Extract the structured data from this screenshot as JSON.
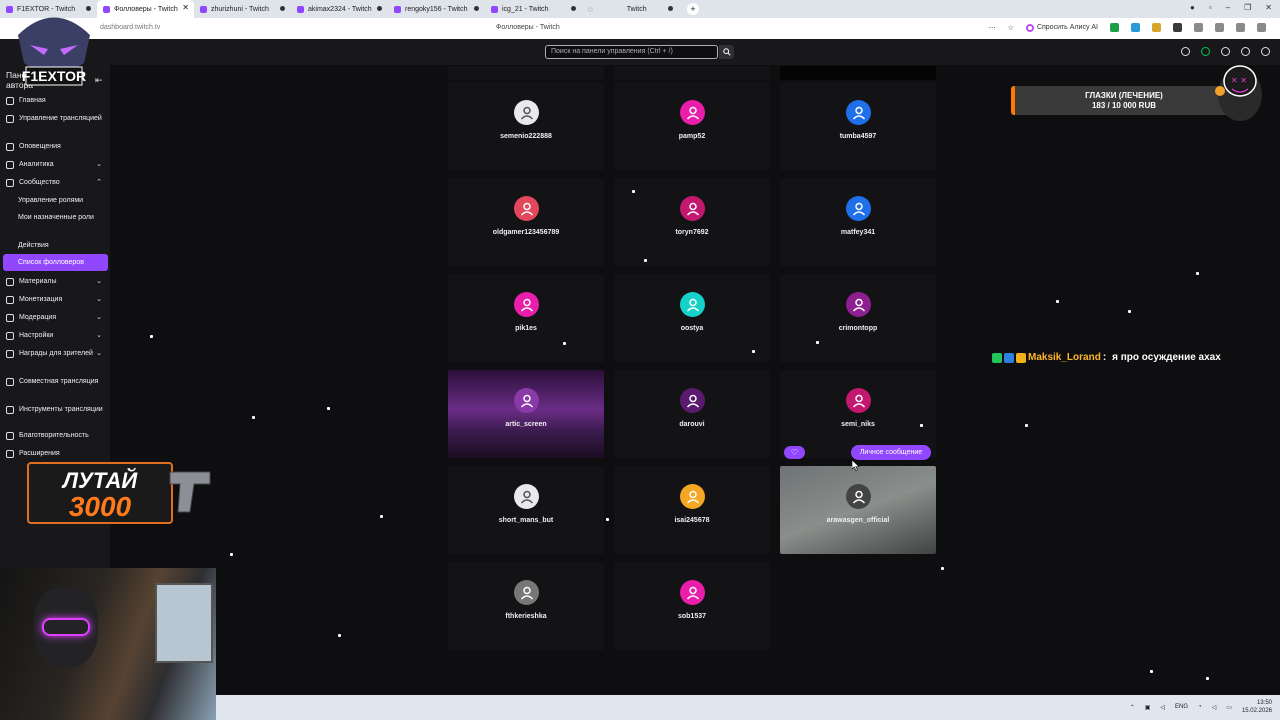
{
  "browser": {
    "tabs": [
      {
        "label": "F1EXTOR - Twitch",
        "active": false
      },
      {
        "label": "Фолловеры - Twitch",
        "active": true
      },
      {
        "label": "zhurizhuni - Twitch",
        "active": false
      },
      {
        "label": "akimax2324 - Twitch",
        "active": false
      },
      {
        "label": "rengoky156 - Twitch",
        "active": false
      },
      {
        "label": "icg_21 - Twitch",
        "active": false
      },
      {
        "label": "Twitch",
        "active": false
      }
    ],
    "url": "dashboard.twitch.tv",
    "page_title": "Фолловеры - Twitch",
    "ask_alice": "Спросить Алису AI"
  },
  "topbar": {
    "search_placeholder": "Поиск на панели управления (Ctrl + /)"
  },
  "sidebar": {
    "header": "Панель управления автора",
    "items": [
      {
        "label": "Главная"
      },
      {
        "label": "Управление трансляцией"
      },
      {
        "label": "Оповещения"
      },
      {
        "label": "Аналитика"
      },
      {
        "label": "Сообщество"
      },
      {
        "label": "Управление ролями"
      },
      {
        "label": "Мои назначенные роли"
      },
      {
        "label": "Действия"
      },
      {
        "label": "Список фолловеров"
      },
      {
        "label": "Материалы"
      },
      {
        "label": "Монетизация"
      },
      {
        "label": "Модерация"
      },
      {
        "label": "Настройки"
      },
      {
        "label": "Награды для зрителей"
      },
      {
        "label": "Совместная трансляция"
      },
      {
        "label": "Инструменты трансляции"
      },
      {
        "label": "Благотворительность"
      },
      {
        "label": "Расширения"
      }
    ]
  },
  "followers": [
    {
      "name": "semenio222888",
      "color": "#e8e8ee"
    },
    {
      "name": "pamp52",
      "color": "#e91eaa"
    },
    {
      "name": "tumba4597",
      "color": "#1f6feb"
    },
    {
      "name": "oldgamer123456789",
      "color": "#e3475c"
    },
    {
      "name": "toryn7692",
      "color": "#c2186f"
    },
    {
      "name": "matfey341",
      "color": "#1f6feb"
    },
    {
      "name": "pik1es",
      "color": "#e91eaa"
    },
    {
      "name": "oostya",
      "color": "#15d1c9"
    },
    {
      "name": "crimontopp",
      "color": "#8e1f91"
    },
    {
      "name": "artic_screen",
      "color": "#8a3aa8"
    },
    {
      "name": "darouvi",
      "color": "#5a1a6e"
    },
    {
      "name": "semi_niks",
      "color": "#c2186f"
    },
    {
      "name": "short_mans_but",
      "color": "#e8e8ee"
    },
    {
      "name": "isai245678",
      "color": "#f5a623"
    },
    {
      "name": "arawasgen_official",
      "color": "#444444"
    },
    {
      "name": "fthkerieshka",
      "color": "#777777"
    },
    {
      "name": "sob1537",
      "color": "#e91eaa"
    }
  ],
  "actions": {
    "direct_message": "Личное сообщение"
  },
  "overlay": {
    "logo_text": "F1EXTOR",
    "goal_title": "ГЛАЗКИ (ЛЕЧЕНИЕ)",
    "goal_progress": "183 / 10 000 RUB",
    "chat_user": "Maksik_Lorand",
    "chat_text": "я про осуждение ахах",
    "promo_line1": "ЛУТАЙ",
    "promo_line2": "3000"
  },
  "taskbar": {
    "lang": "ENG",
    "time": "13:50",
    "date": "15.02.2026"
  }
}
